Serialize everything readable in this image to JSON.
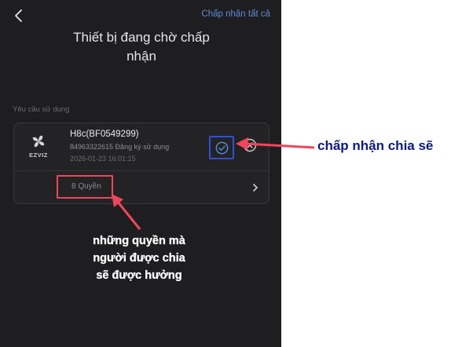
{
  "header": {
    "back_icon": "chevron-left-icon",
    "accept_all_label": "Chấp nhận tất cả",
    "title_line1": "Thiết bị đang chờ chấp",
    "title_line2": "nhận"
  },
  "section": {
    "label": "Yêu cầu sử dụng"
  },
  "request_card": {
    "brand_label": "EZVIZ",
    "device_name": "H8c(BF0549299)",
    "register_info": "84963322615 Đăng ký sử dụng",
    "timestamp": "2026-01-23 16:01:15",
    "accept_icon": "check-circle-icon",
    "reject_icon": "x-circle-icon",
    "permissions_label": "8 Quyền",
    "permissions_icon": "chevron-right-icon"
  },
  "annotations": {
    "accept_note": "chấp nhận chia sẽ",
    "perm_note_line1": "những quyền mà",
    "perm_note_line2": "người được chia",
    "perm_note_line3": "sẽ được hưởng"
  },
  "colors": {
    "background": "#1e1e20",
    "accent_link": "#5b8cd6",
    "highlight_red": "#f0455a",
    "highlight_blue": "#2f50d8",
    "annotation_navy": "#0c1a86"
  }
}
